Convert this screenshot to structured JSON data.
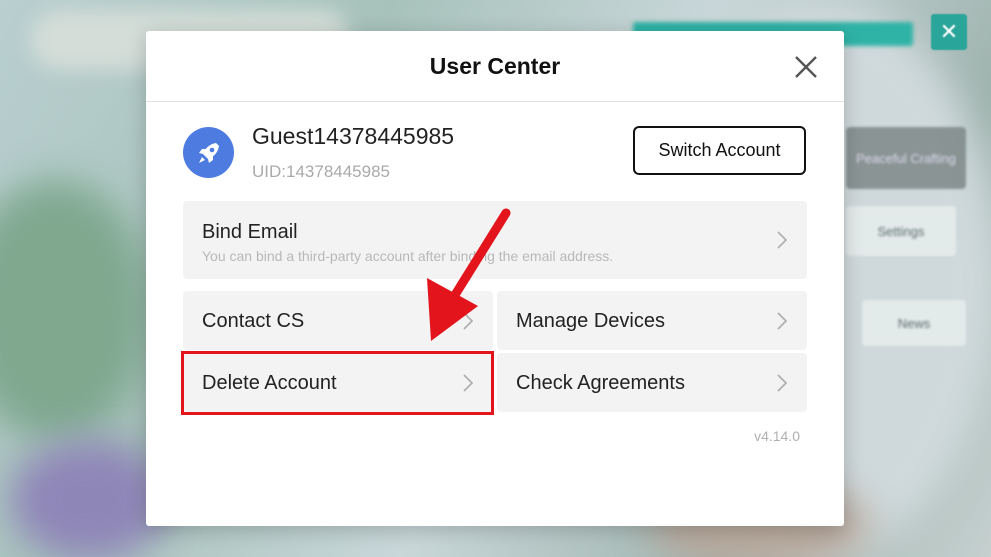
{
  "dialog": {
    "title": "User Center",
    "close_icon": "close-icon"
  },
  "account": {
    "avatar_icon": "rocket-icon",
    "avatar_color": "#4d7be0",
    "username": "Guest14378445985",
    "uid": "UID:14378445985",
    "switch_label": "Switch Account"
  },
  "options": {
    "bind_email": {
      "label": "Bind Email",
      "description": "You can bind a third-party account after binding the email address."
    },
    "contact_cs": "Contact CS",
    "manage_devices": "Manage Devices",
    "delete_account": "Delete Account",
    "check_agreements": "Check Agreements"
  },
  "version": "v4.14.0",
  "annotation": {
    "highlight_color": "#e3141c",
    "target": "Delete Account"
  },
  "background": {
    "buttons": [
      "Peaceful Crafting",
      "Settings",
      "News"
    ]
  }
}
